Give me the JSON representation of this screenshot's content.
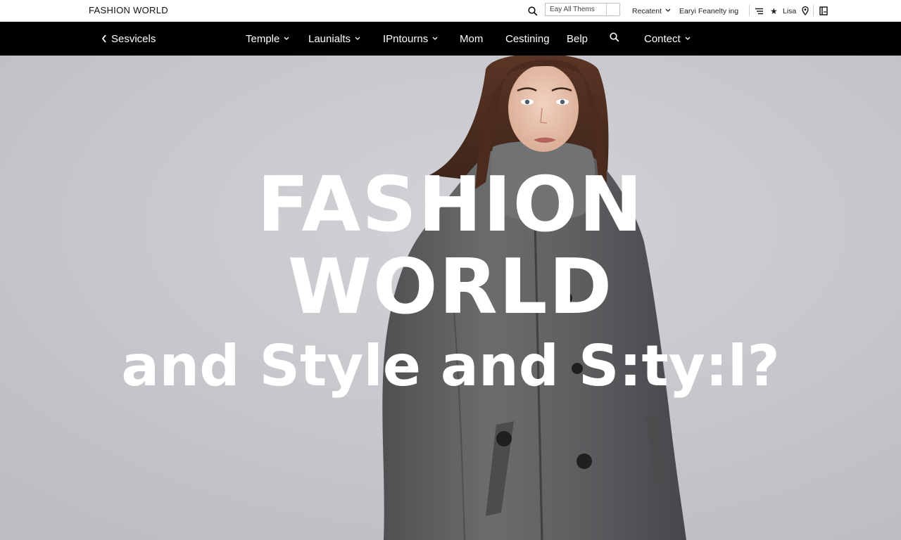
{
  "brand": "FASHION WORLD",
  "topbar": {
    "search_placeholder": "Eay All Thems",
    "recent_label": "Recatent",
    "early_label": "Earyi Feanelty ing",
    "lisa_label": "Lisa",
    "icons": [
      "search-icon",
      "menu-icon",
      "star-icon",
      "location-pin-icon",
      "book-icon"
    ]
  },
  "nav": {
    "back_label": "Sesvicels",
    "items": [
      {
        "label": "Temple",
        "has_dropdown": true
      },
      {
        "label": "Launialts",
        "has_dropdown": true
      },
      {
        "label": "IPntourns",
        "has_dropdown": true
      },
      {
        "label": "Mom",
        "has_dropdown": false
      },
      {
        "label": "Cestining",
        "has_dropdown": false
      },
      {
        "label": "Belp",
        "has_dropdown": false
      },
      {
        "label": "",
        "icon": "search-icon"
      },
      {
        "label": "Contect",
        "has_dropdown": true
      }
    ]
  },
  "hero": {
    "line1": "FASHION",
    "line2": "WORLD",
    "line3": "and Style and S:ty:l?",
    "image_subject": "model-in-gray-wool-coat",
    "background_color": "#c5c5ca"
  },
  "colors": {
    "nav_bg": "#000000",
    "topbar_bg": "#ffffff",
    "headline": "#ffffff",
    "coat": "#5c5e60"
  }
}
